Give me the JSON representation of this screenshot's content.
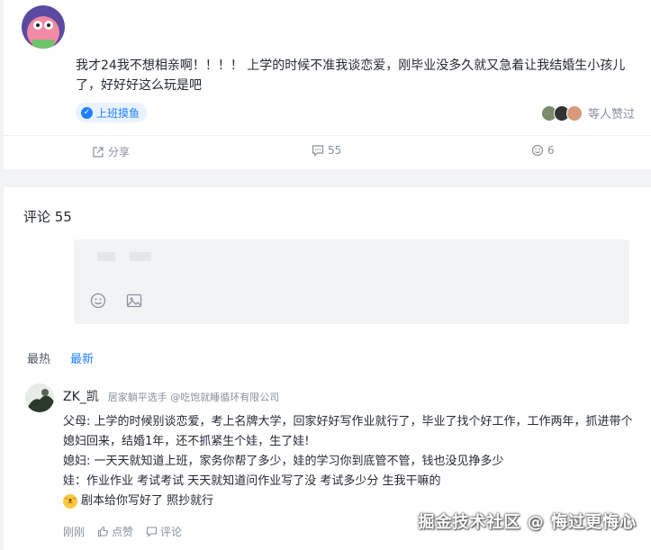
{
  "post": {
    "text": "我才24我不想相亲啊！！！！  上学的时候不准我谈恋爱，刚毕业没多久就又急着让我结婚生小孩儿了，好好好这么玩是吧",
    "topic_tag": "上班摸鱼",
    "likes_text": "等人赞过",
    "actions": {
      "share": "分享",
      "comments": "55",
      "likes": "6"
    }
  },
  "comments": {
    "title": "评论 55",
    "sort": {
      "hot": "最热",
      "new": "最新"
    },
    "items": [
      {
        "user": "ZK_凯",
        "bio": "居家躺平选手 @吃饱就睡循环有限公司",
        "lines": [
          "父母: 上学的时候别谈恋爱，考上名牌大学，回家好好写作业就行了，毕业了找个好工作，工作两年，抓进带个媳妇回来，结婚1年，还不抓紧生个娃，生了娃!",
          "媳妇: 一天天就知道上班，家务你帮了多少，娃的学习你到底管不管，钱也没见挣多少",
          "娃：作业作业 考试考试 天天就知道问作业写了没 考试多少分 生我干嘛的",
          "剧本给你写好了 照抄就行"
        ],
        "time": "刚刚",
        "like_label": "点赞",
        "reply_label": "评论"
      }
    ]
  },
  "watermark": "掘金技术社区 @ 悔过更悔心",
  "colors": {
    "accent": "#1e80ff",
    "text": "#252933",
    "muted": "#8a919f",
    "bg": "#f2f3f5"
  }
}
